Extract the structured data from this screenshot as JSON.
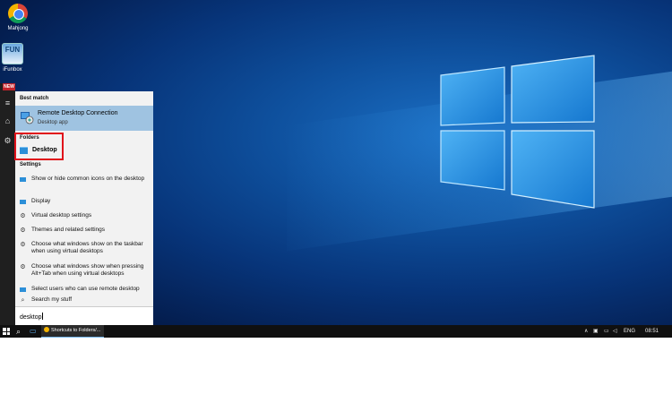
{
  "desktop": {
    "icons": [
      {
        "label": "Mahjong",
        "icon": "chrome-icon"
      },
      {
        "label": "iFunbox",
        "icon": "funbox-icon"
      }
    ]
  },
  "rail": {
    "new_badge": "NEW",
    "hamburger": "≡",
    "home": "⌂",
    "settings": "⚙"
  },
  "search_panel": {
    "best_match_heading": "Best match",
    "best_match": {
      "title": "Remote Desktop Connection",
      "subtitle": "Desktop app",
      "icon": "remote-desktop-icon"
    },
    "folders_heading": "Folders",
    "folder_item": {
      "label": "Desktop",
      "icon": "folder-icon"
    },
    "settings_heading": "Settings",
    "settings_items": [
      {
        "label": "Show or hide common icons on the desktop",
        "icon": "monitor-icon"
      },
      {
        "label": "Display",
        "icon": "monitor-icon"
      },
      {
        "label": "Virtual desktop settings",
        "icon": "gear-icon"
      },
      {
        "label": "Themes and related settings",
        "icon": "gear-icon"
      },
      {
        "label": "Choose what windows show on the taskbar when using virtual desktops",
        "icon": "gear-icon"
      },
      {
        "label": "Choose what windows show when pressing Alt+Tab when using virtual desktops",
        "icon": "gear-icon"
      },
      {
        "label": "Select users who can use remote desktop",
        "icon": "monitor-icon"
      },
      {
        "label": "Search my stuff",
        "icon": "search-icon"
      }
    ],
    "search_value": "desktop"
  },
  "taskbar": {
    "start_icon": "windows-icon",
    "search_glyph": "⌕",
    "task_view_glyph": "▭",
    "app_label": "Shortcuts to Folders/...",
    "tray": {
      "up": "∧",
      "language": "ENG",
      "time": "08:51"
    }
  },
  "colors": {
    "selection": "#9fc3e1",
    "highlight_border": "#e0121b",
    "panel_bg": "#f2f2f2",
    "taskbar_bg": "#101010"
  }
}
